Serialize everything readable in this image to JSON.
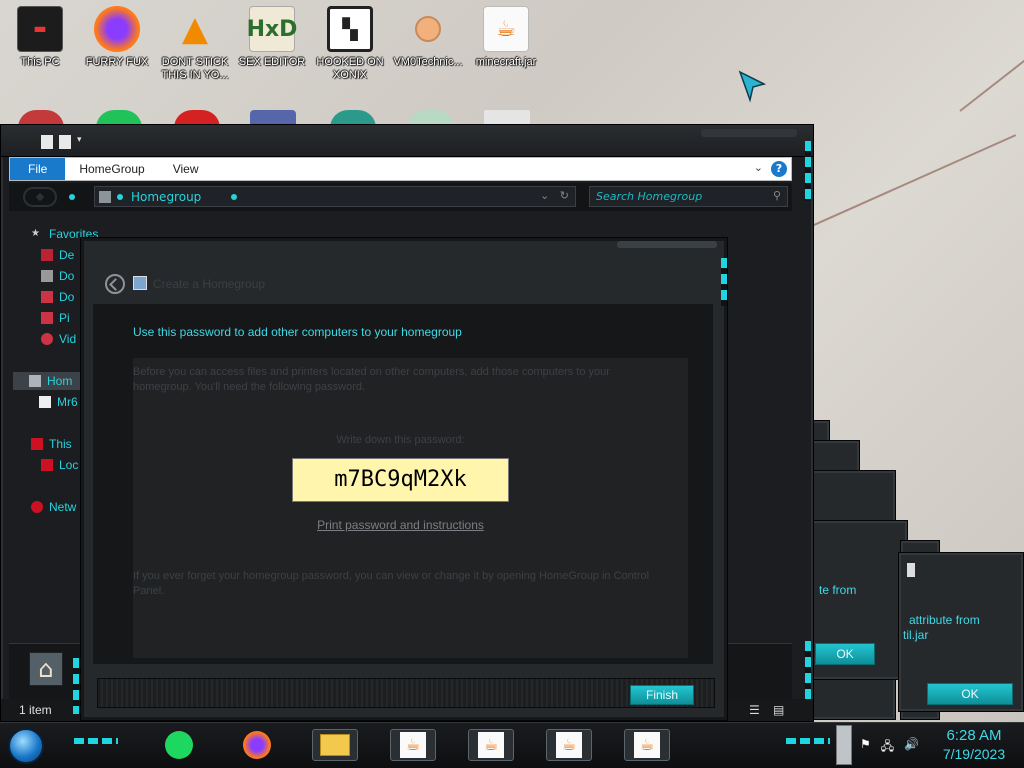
{
  "desktop": {
    "icons": [
      {
        "label": "This PC",
        "icon": "monitor-icon"
      },
      {
        "label": "FURRY FUX",
        "icon": "firefox-icon"
      },
      {
        "label": "DONT STICK THIS IN YO...",
        "icon": "vlc-icon"
      },
      {
        "label": "SEX EDITOR",
        "icon": "hxd-icon"
      },
      {
        "label": "HOOKED ON XONIX",
        "icon": "game-icon"
      },
      {
        "label": "VM0Technic...",
        "icon": "doctor-icon"
      },
      {
        "label": "minecraft.jar",
        "icon": "java-icon"
      }
    ]
  },
  "explorer": {
    "ribbon_tabs": [
      "File",
      "HomeGroup",
      "View"
    ],
    "address": "Homegroup",
    "search_placeholder": "Search Homegroup",
    "nav": {
      "favorites": "Favorites",
      "fav_items": [
        "De",
        "Do",
        "Do",
        "Pi",
        "Vid"
      ],
      "homegroup": "Hom",
      "homegroup_user": "Mr6",
      "this_pc": "This",
      "local_disk": "Loc",
      "network": "Netw"
    },
    "status": "1 item"
  },
  "dialog": {
    "title": "Create a Homegroup",
    "heading": "Use this password to add other computers to your homegroup",
    "para1": "Before you can access files and printers located on other computers, add those computers to your homegroup. You'll need the following password.",
    "write_down": "Write down this password:",
    "password": "m7BC9qM2Xk",
    "print_link": "Print password and instructions",
    "para2": "If you ever forget your homegroup password, you can view or change it by opening HomeGroup in Control Panel.",
    "finish": "Finish"
  },
  "background_dialogs": [
    {
      "text": "te from",
      "ok": "OK"
    },
    {
      "text_line1": "attribute from",
      "text_line2": "til.jar",
      "ok": "OK"
    }
  ],
  "taskbar": {
    "time": "6:28 AM",
    "date": "7/19/2023",
    "apps": [
      "spotify-icon",
      "firefox-icon",
      "file-explorer-icon",
      "java-icon",
      "java-icon",
      "java-icon",
      "java-icon"
    ]
  },
  "colors": {
    "accent": "#27d3df",
    "password_bg": "#fff5ad",
    "button": "#15aab5"
  }
}
